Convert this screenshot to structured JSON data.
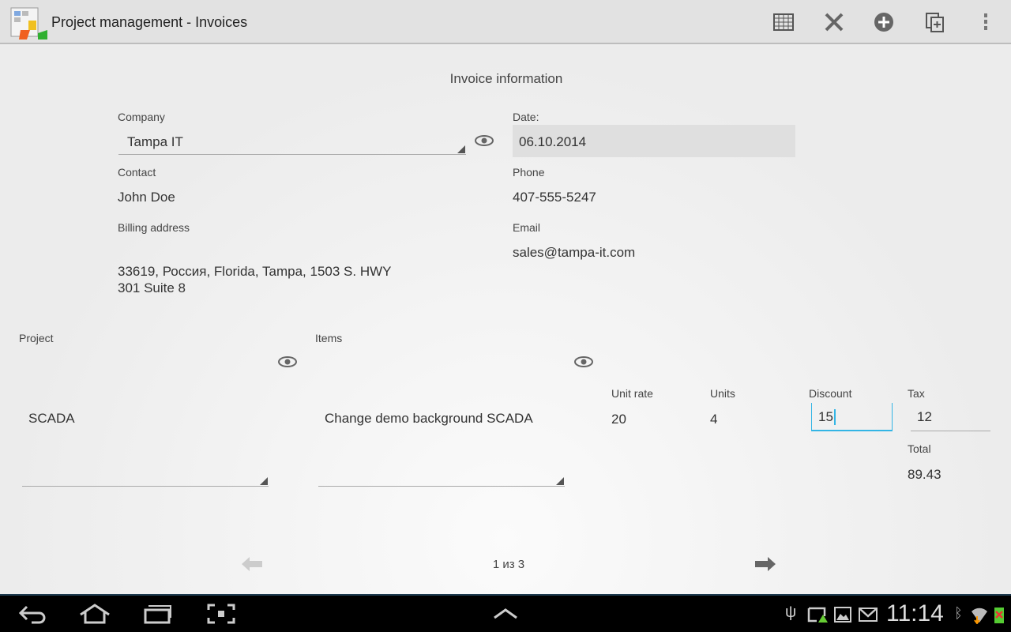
{
  "app": {
    "title": "Project management - Invoices",
    "actions": [
      "grid-icon",
      "tools-icon",
      "add-icon",
      "copy-icon",
      "overflow-menu-icon"
    ]
  },
  "form": {
    "heading": "Invoice information",
    "company_label": "Company",
    "company": "Tampa IT",
    "date_label": "Date:",
    "date": "06.10.2014",
    "contact_label": "Contact",
    "contact": "John Doe",
    "phone_label": "Phone",
    "phone": "407-555-5247",
    "billing_label": "Billing address",
    "billing_line1": "33619, Россия, Florida, Tampa, 1503 S. HWY",
    "billing_line2": "301 Suite 8",
    "email_label": "Email",
    "email": "sales@tampa-it.com"
  },
  "line": {
    "project_label": "Project",
    "project": "SCADA",
    "items_label": "Items",
    "item": "Change demo background SCADA",
    "unit_rate_label": "Unit rate",
    "unit_rate": "20",
    "units_label": "Units",
    "units": "4",
    "discount_label": "Discount",
    "discount": "15",
    "tax_label": "Tax",
    "tax": "12",
    "total_label": "Total",
    "total": "89.43"
  },
  "pager": {
    "text": "1 из 3"
  },
  "status": {
    "time": "11:14"
  },
  "colors": {
    "accent": "#33b5e5"
  }
}
